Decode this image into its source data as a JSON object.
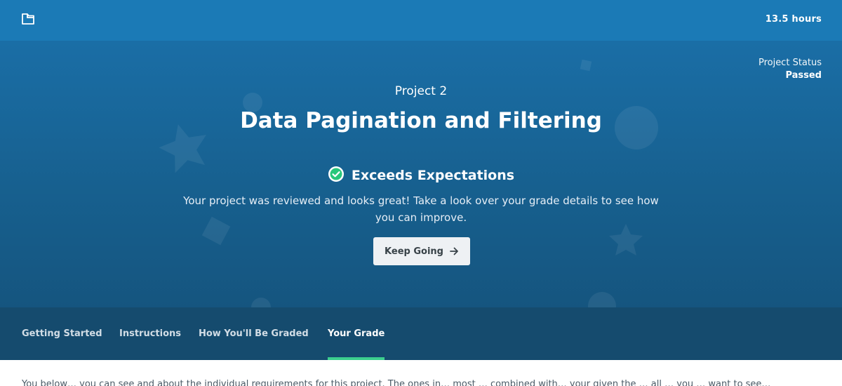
{
  "topbar": {
    "hours": "13.5 hours"
  },
  "status": {
    "label": "Project Status",
    "value": "Passed"
  },
  "hero": {
    "subtitle": "Project 2",
    "title": "Data Pagination and Filtering",
    "grade": "Exceeds Expectations",
    "description": "Your project was reviewed and looks great! Take a look over your grade details to see how you can improve.",
    "button_label": "Keep Going"
  },
  "tabs": [
    {
      "label": "Getting Started"
    },
    {
      "label": "Instructions"
    },
    {
      "label": "How You'll Be Graded"
    },
    {
      "label": "Your Grade"
    }
  ],
  "active_tab": "Your Grade",
  "content": {
    "paragraph": "You below… you can see and about the individual requirements for this project. The ones in… most … combined with… your given the … all … you … want to see…"
  },
  "colors": {
    "topbar": "#1b7ab6",
    "hero": "#17608f",
    "tabs_bg": "#154b6e",
    "tab_underline": "#3ccf8e",
    "check_green": "#28c77a"
  },
  "icons": [
    "folder-icon",
    "check-circle-icon",
    "arrow-right-icon"
  ]
}
